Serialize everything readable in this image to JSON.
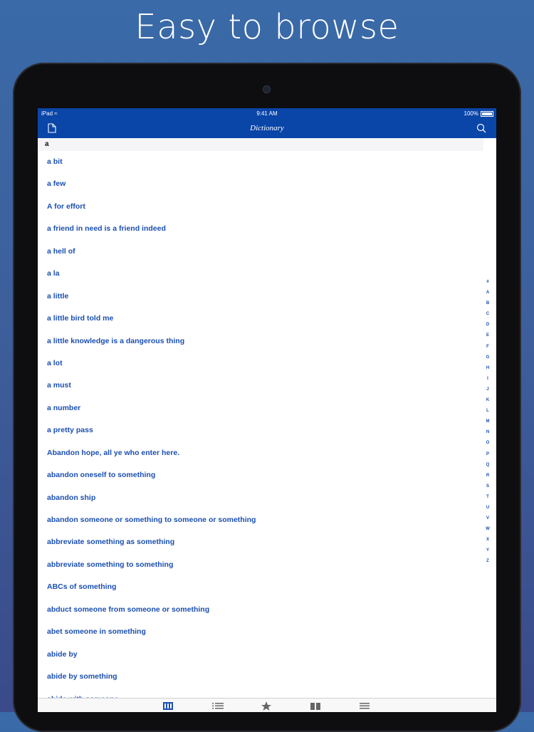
{
  "promo": {
    "title": "Easy to browse"
  },
  "status_bar": {
    "device": "iPad",
    "time": "9:41 AM",
    "battery": "100%"
  },
  "nav": {
    "title": "Dictionary",
    "left_icon": "document-icon",
    "right_icon": "search-icon"
  },
  "section": {
    "header": "a"
  },
  "entries": [
    "a bit",
    "a few",
    "A for effort",
    "a friend in need is a friend indeed",
    "a hell of",
    "a la",
    "a little",
    "a little bird told me",
    "a little knowledge is a dangerous thing",
    "a lot",
    "a must",
    "a number",
    "a pretty pass",
    "Abandon hope, all ye who enter here.",
    "abandon oneself to something",
    "abandon ship",
    "abandon someone or something to someone or something",
    "abbreviate something as something",
    "abbreviate something to something",
    "ABCs of something",
    "abduct someone from someone or something",
    "abet someone in something",
    "abide by",
    "abide by something",
    "abide with someone"
  ],
  "index_letters": [
    "#",
    "A",
    "B",
    "C",
    "D",
    "E",
    "F",
    "G",
    "H",
    "I",
    "J",
    "K",
    "L",
    "M",
    "N",
    "O",
    "P",
    "Q",
    "R",
    "S",
    "T",
    "U",
    "V",
    "W",
    "X",
    "Y",
    "Z"
  ],
  "tab_bar": {
    "tabs": [
      {
        "icon": "dictionary-icon",
        "active": true
      },
      {
        "icon": "list-icon",
        "active": false
      },
      {
        "icon": "star-icon",
        "active": false
      },
      {
        "icon": "book-icon",
        "active": false
      },
      {
        "icon": "menu-icon",
        "active": false
      }
    ]
  },
  "colors": {
    "accent": "#0a45a8",
    "link": "#1b4fb0",
    "background": "#3d5f9c"
  }
}
